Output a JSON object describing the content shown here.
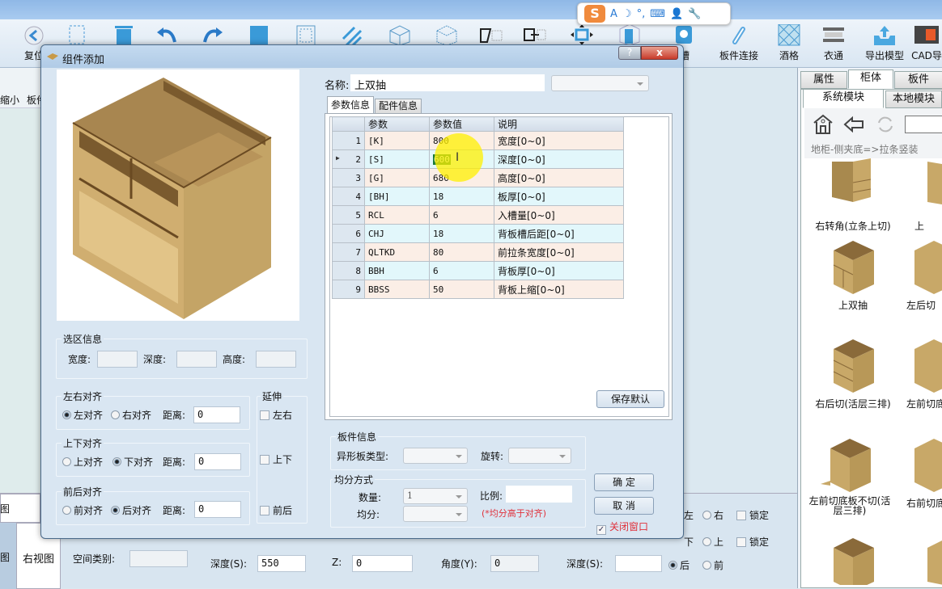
{
  "toolbar": {
    "items": [
      {
        "label": "复位",
        "icon": "reset-icon"
      },
      {
        "label": "",
        "icon": "select-icon"
      },
      {
        "label": "",
        "icon": "trash-icon"
      },
      {
        "label": "",
        "icon": "undo-icon"
      },
      {
        "label": "",
        "icon": "redo-icon"
      },
      {
        "label": "",
        "icon": "panel-fill-icon"
      },
      {
        "label": "",
        "icon": "panel-frame-icon"
      },
      {
        "label": "",
        "icon": "hatch-icon"
      },
      {
        "label": "",
        "icon": "cube-icon"
      },
      {
        "label": "",
        "icon": "cube-dashed-icon"
      },
      {
        "label": "",
        "icon": "slant-icon"
      },
      {
        "label": "",
        "icon": "move-right-icon"
      },
      {
        "label": "",
        "icon": "resize-icon"
      },
      {
        "label": "",
        "icon": "door-icon"
      },
      {
        "label": "槽",
        "icon": "groove-icon"
      },
      {
        "label": "板件连接",
        "icon": "link-icon"
      },
      {
        "label": "酒格",
        "icon": "wine-grid-icon"
      },
      {
        "label": "衣通",
        "icon": "hanger-rod-icon"
      },
      {
        "label": "导出模型",
        "icon": "export-icon"
      },
      {
        "label": "CAD导",
        "icon": "cad-icon"
      }
    ]
  },
  "ime": {
    "letter": "S",
    "glyphs": [
      "A",
      "☽",
      "°,",
      "⌨",
      "👤",
      "🔧"
    ]
  },
  "leftstrip": {
    "items": [
      "缩小",
      "板件"
    ]
  },
  "dialog": {
    "title": "组件添加",
    "help_label": "?",
    "close_label": "x",
    "name_label": "名称:",
    "name_value": "上双抽",
    "tabs": [
      "参数信息",
      "配件信息"
    ],
    "table": {
      "headers": [
        "",
        "参数",
        "参数值",
        "说明"
      ],
      "rows": [
        {
          "n": "1",
          "param": "[K]",
          "value": "800",
          "desc": "宽度[0~0]"
        },
        {
          "n": "2",
          "param": "[S]",
          "value": "600",
          "desc": "深度[0~0]",
          "selected": true
        },
        {
          "n": "3",
          "param": "[G]",
          "value": "680",
          "desc": "高度[0~0]"
        },
        {
          "n": "4",
          "param": "[BH]",
          "value": "18",
          "desc": "板厚[0~0]"
        },
        {
          "n": "5",
          "param": "RCL",
          "value": "6",
          "desc": "入槽量[0~0]"
        },
        {
          "n": "6",
          "param": "CHJ",
          "value": "18",
          "desc": "背板槽后距[0~0]"
        },
        {
          "n": "7",
          "param": "QLTKD",
          "value": "80",
          "desc": "前拉条宽度[0~0]"
        },
        {
          "n": "8",
          "param": "BBH",
          "value": "6",
          "desc": "背板厚[0~0]"
        },
        {
          "n": "9",
          "param": "BBSS",
          "value": "50",
          "desc": "背板上缩[0~0]"
        }
      ]
    },
    "save_default": "保存默认",
    "selection": {
      "title": "选区信息",
      "width_label": "宽度:",
      "depth_label": "深度:",
      "height_label": "高度:",
      "width": "",
      "depth": "",
      "height": ""
    },
    "lr_align": {
      "title": "左右对齐",
      "opt1": "左对齐",
      "opt2": "右对齐",
      "selected": "左对齐",
      "dist_label": "距离:",
      "dist": "0"
    },
    "ud_align": {
      "title": "上下对齐",
      "opt1": "上对齐",
      "opt2": "下对齐",
      "selected": "下对齐",
      "dist_label": "距离:",
      "dist": "0"
    },
    "fb_align": {
      "title": "前后对齐",
      "opt1": "前对齐",
      "opt2": "后对齐",
      "selected": "后对齐",
      "dist_label": "距离:",
      "dist": "0"
    },
    "extend": {
      "title": "延伸",
      "lr": "左右",
      "ud": "上下",
      "fb": "前后"
    },
    "panel_info": {
      "title": "板件信息",
      "shape_label": "异形板类型:",
      "shape_value": "",
      "rotate_label": "旋转:",
      "rotate_value": ""
    },
    "split": {
      "title": "均分方式",
      "count_label": "数量:",
      "count_value": "1",
      "ratio_label": "比例:",
      "ratio_value": "",
      "split_label": "均分:",
      "split_value": "",
      "note": "(*均分高于对齐)"
    },
    "ok_label": "确 定",
    "cancel_label": "取 消",
    "close_window_label": "关闭窗口",
    "close_window_checked": true
  },
  "rightpanel": {
    "tabs": [
      "属性",
      "柜体",
      "板件"
    ],
    "active_tab": "柜体",
    "subtabs": [
      "系统模块",
      "本地模块"
    ],
    "breadcrumb": "地柜-侧夹底=>拉条竖装",
    "items": [
      "右转角(立条上切)",
      "上",
      "上双抽",
      "左后切",
      "右后切(活层三排)",
      "左前切底",
      "左前切底板不切(活层三排)",
      "右前切底"
    ]
  },
  "bottom": {
    "view_left": "图",
    "view_left2": "图",
    "view_right": "右视图",
    "space_label": "空间类别:",
    "space_value": "",
    "depth_label": "深度(S):",
    "depth_value": "550",
    "z_label": "Z:",
    "z_value": "0",
    "angle_label": "角度(Y):",
    "angle_value": "0",
    "depth2_label": "深度(S):",
    "depth2_value": "",
    "r1": [
      "左",
      "右",
      "锁定"
    ],
    "r2": [
      "下",
      "上",
      "锁定"
    ],
    "r3": [
      "后",
      "前"
    ]
  }
}
